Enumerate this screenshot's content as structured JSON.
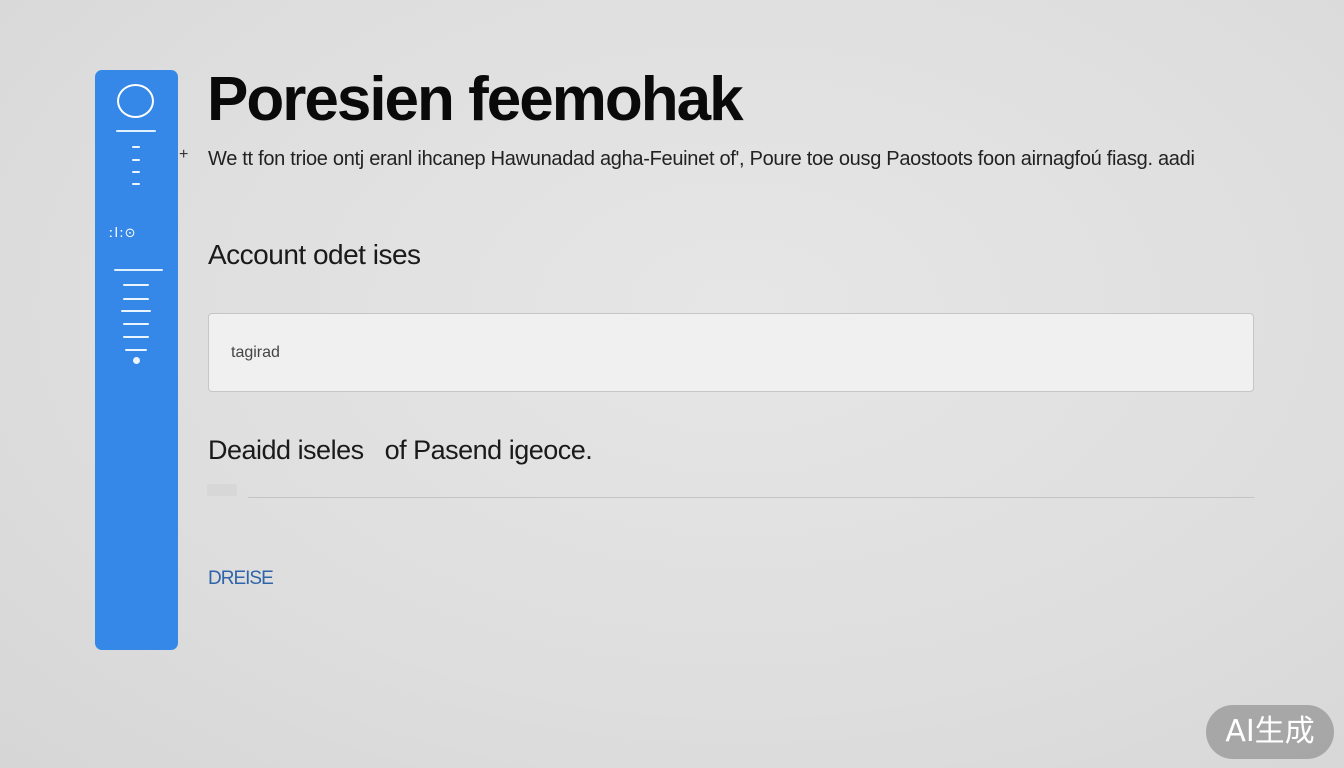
{
  "sidebar": {
    "glyph_label": "ːI:⊙",
    "icons": [
      "circle-icon",
      "menu-lines-icon"
    ],
    "accent_color": "#3588e8"
  },
  "header": {
    "title": "Poresien feemohak",
    "description": "We tt fon trioe ontj eranl ihcanep Hawunadad agha-Feuinet of', Poure toe ousg Paostoots foon airnagfoú fiasg. aadi"
  },
  "account": {
    "section_title": "Account odet ises",
    "input_value": "tagirad"
  },
  "details": {
    "section_title": "Deaidd iseles   of Pasend igeoce."
  },
  "footer": {
    "link_label": "DREISE"
  },
  "watermark": {
    "label": "AI生成"
  }
}
